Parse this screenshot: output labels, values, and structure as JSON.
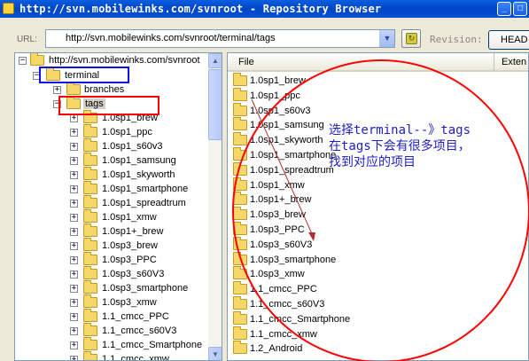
{
  "window": {
    "title": "http://svn.mobilewinks.com/svnroot - Repository Browser",
    "controls": [
      "_",
      "□"
    ]
  },
  "toolbar": {
    "url_label": "URL:",
    "url_value": "http://svn.mobilewinks.com/svnroot/terminal/tags",
    "revision_label": "Revision:",
    "head_label": "HEAD"
  },
  "tree": {
    "root": "http://svn.mobilewinks.com/svnroot",
    "terminal": "terminal",
    "branches": "branches",
    "tags": "tags",
    "items": [
      "1.0sp1_brew",
      "1.0sp1_ppc",
      "1.0sp1_s60v3",
      "1.0sp1_samsung",
      "1.0sp1_skyworth",
      "1.0sp1_smartphone",
      "1.0sp1_spreadtrum",
      "1.0sp1_xmw",
      "1.0sp1+_brew",
      "1.0sp3_brew",
      "1.0sp3_PPC",
      "1.0sp3_s60V3",
      "1.0sp3_smartphone",
      "1.0sp3_xmw",
      "1.1_cmcc_PPC",
      "1.1_cmcc_s60V3",
      "1.1_cmcc_Smartphone",
      "1.1_cmcc_xmw"
    ]
  },
  "file_list": {
    "col_file": "File",
    "col_ext": "Exten",
    "items": [
      "1.0sp1_brew",
      "1.0sp1_ppc",
      "1.0sp1_s60v3",
      "1.0sp1_samsung",
      "1.0sp1_skyworth",
      "1.0sp1_smartphone",
      "1.0sp1_spreadtrum",
      "1.0sp1_xmw",
      "1.0sp1+_brew",
      "1.0sp3_brew",
      "1.0sp3_PPC",
      "1.0sp3_s60V3",
      "1.0sp3_smartphone",
      "1.0sp3_xmw",
      "1.1_cmcc_PPC",
      "1.1_cmcc_s60V3",
      "1.1_cmcc_Smartphone",
      "1.1_cmcc_xmw",
      "1.2_Android"
    ]
  },
  "annotation": {
    "text": "选择terminal--》tags\n在tags下会有很多项目，\n找到对应的项目",
    "color": "#2020c8"
  },
  "colors": {
    "highlight_red": "#ff0000",
    "highlight_blue": "#1010ee",
    "titlebar": "#0346c8"
  }
}
